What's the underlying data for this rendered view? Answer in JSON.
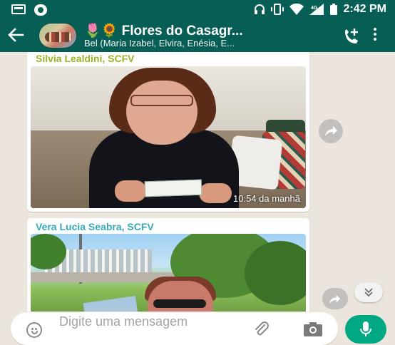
{
  "status_bar": {
    "time": "2:42 PM",
    "network": "4G"
  },
  "header": {
    "title": "🌷🌻 Flores do Casagr...",
    "subtitle": "Bel (Maria Izabel, Elvira, Enésia, E...",
    "colors": {
      "bar": "#075e54",
      "accent": "#00a884"
    }
  },
  "messages": [
    {
      "sender": "Silvia Lealdini, SCFV",
      "time": "10:54 da manhã",
      "type": "image"
    },
    {
      "sender": "Vera Lucia Seabra, SCFV",
      "type": "image"
    }
  ],
  "composer": {
    "placeholder": "Digite uma mensagem"
  },
  "icons": [
    "back-arrow-icon",
    "add-call-icon",
    "menu-icon",
    "forward-icon",
    "scroll-down-icon",
    "emoji-icon",
    "attach-icon",
    "camera-icon",
    "mic-icon"
  ]
}
